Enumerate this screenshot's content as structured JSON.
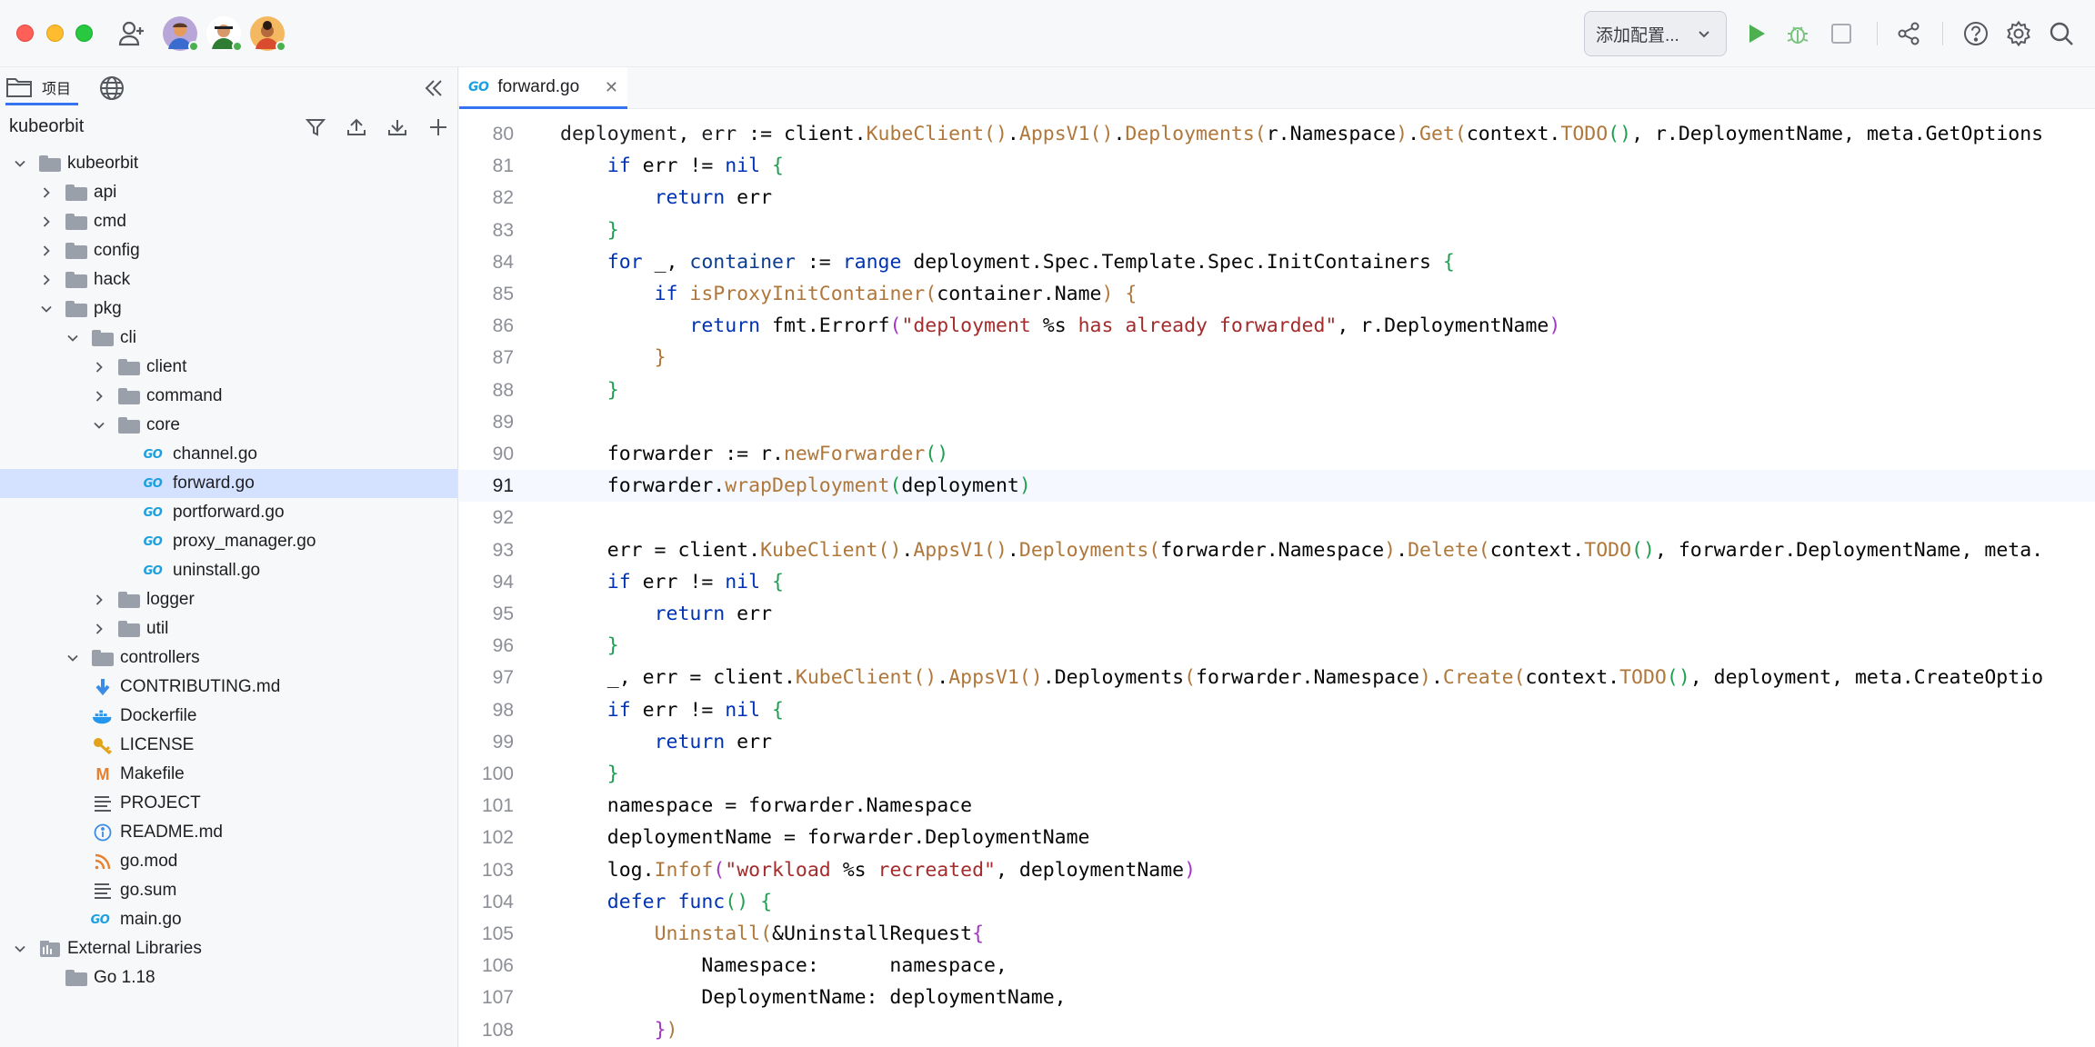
{
  "titlebar": {
    "run_config_label": "添加配置...",
    "colors": {
      "run": "#4caf50",
      "debug": "#4caf50"
    }
  },
  "left_panel": {
    "tab_project_label": "项目",
    "root_label": "kubeorbit",
    "tree": [
      {
        "label": "kubeorbit",
        "kind": "folder",
        "depth": 0,
        "expanded": true
      },
      {
        "label": "api",
        "kind": "folder",
        "depth": 1,
        "expanded": false
      },
      {
        "label": "cmd",
        "kind": "folder",
        "depth": 1,
        "expanded": false
      },
      {
        "label": "config",
        "kind": "folder",
        "depth": 1,
        "expanded": false
      },
      {
        "label": "hack",
        "kind": "folder",
        "depth": 1,
        "expanded": false
      },
      {
        "label": "pkg",
        "kind": "folder",
        "depth": 1,
        "expanded": true
      },
      {
        "label": "cli",
        "kind": "folder",
        "depth": 2,
        "expanded": true
      },
      {
        "label": "client",
        "kind": "folder",
        "depth": 3,
        "expanded": false
      },
      {
        "label": "command",
        "kind": "folder",
        "depth": 3,
        "expanded": false
      },
      {
        "label": "core",
        "kind": "folder",
        "depth": 3,
        "expanded": true
      },
      {
        "label": "channel.go",
        "kind": "go",
        "depth": 4
      },
      {
        "label": "forward.go",
        "kind": "go",
        "depth": 4,
        "selected": true
      },
      {
        "label": "portforward.go",
        "kind": "go",
        "depth": 4
      },
      {
        "label": "proxy_manager.go",
        "kind": "go",
        "depth": 4
      },
      {
        "label": "uninstall.go",
        "kind": "go",
        "depth": 4
      },
      {
        "label": "logger",
        "kind": "folder",
        "depth": 3,
        "expanded": false
      },
      {
        "label": "util",
        "kind": "folder",
        "depth": 3,
        "expanded": false
      },
      {
        "label": "controllers",
        "kind": "folder",
        "depth": 2,
        "expanded": true
      },
      {
        "label": "CONTRIBUTING.md",
        "kind": "md-down",
        "depth": 2
      },
      {
        "label": "Dockerfile",
        "kind": "docker",
        "depth": 2
      },
      {
        "label": "LICENSE",
        "kind": "key",
        "depth": 2
      },
      {
        "label": "Makefile",
        "kind": "make",
        "depth": 2
      },
      {
        "label": "PROJECT",
        "kind": "text",
        "depth": 2
      },
      {
        "label": "README.md",
        "kind": "info",
        "depth": 2
      },
      {
        "label": "go.mod",
        "kind": "rss",
        "depth": 2
      },
      {
        "label": "go.sum",
        "kind": "text",
        "depth": 2
      },
      {
        "label": "main.go",
        "kind": "go",
        "depth": 2
      },
      {
        "label": "External Libraries",
        "kind": "lib",
        "depth": 0,
        "expanded": true
      },
      {
        "label": "Go 1.18",
        "kind": "folder",
        "depth": 1
      }
    ]
  },
  "editor": {
    "tab_label": "forward.go",
    "go_badge": "GO",
    "current_line": 91,
    "lines": [
      {
        "n": "80",
        "tokens": [
          [
            "var",
            "deployment"
          ],
          [
            "p",
            ", "
          ],
          [
            "var",
            "err"
          ],
          [
            "p",
            " := client."
          ],
          [
            "fn",
            "KubeClient"
          ],
          [
            "br2",
            "()"
          ],
          [
            "p",
            "."
          ],
          [
            "fn",
            "AppsV1"
          ],
          [
            "br2",
            "()"
          ],
          [
            "p",
            "."
          ],
          [
            "fn",
            "Deployments"
          ],
          [
            "br2",
            "("
          ],
          [
            "p",
            "r.Namespace"
          ],
          [
            "br2",
            ")"
          ],
          [
            "p",
            "."
          ],
          [
            "fn",
            "Get"
          ],
          [
            "br2",
            "("
          ],
          [
            "p",
            "context."
          ],
          [
            "fn",
            "TODO"
          ],
          [
            "br1",
            "()"
          ],
          [
            "p",
            ", r.DeploymentName, meta.GetOptions"
          ]
        ]
      },
      {
        "n": "81",
        "tokens": [
          [
            "p",
            "    "
          ],
          [
            "kw",
            "if"
          ],
          [
            "p",
            " err != "
          ],
          [
            "kw",
            "nil"
          ],
          [
            "p",
            " "
          ],
          [
            "br1",
            "{"
          ]
        ]
      },
      {
        "n": "82",
        "tokens": [
          [
            "p",
            "        "
          ],
          [
            "kw",
            "return"
          ],
          [
            "p",
            " err"
          ]
        ]
      },
      {
        "n": "83",
        "tokens": [
          [
            "p",
            "    "
          ],
          [
            "br1",
            "}"
          ]
        ]
      },
      {
        "n": "84",
        "tokens": [
          [
            "p",
            "    "
          ],
          [
            "kw",
            "for"
          ],
          [
            "p",
            " _, "
          ],
          [
            "id",
            "container"
          ],
          [
            "p",
            " := "
          ],
          [
            "kw",
            "range"
          ],
          [
            "p",
            " deployment.Spec.Template.Spec.InitContainers "
          ],
          [
            "br1",
            "{"
          ]
        ]
      },
      {
        "n": "85",
        "tokens": [
          [
            "p",
            "        "
          ],
          [
            "kw",
            "if"
          ],
          [
            "p",
            " "
          ],
          [
            "fn",
            "isProxyInitContainer"
          ],
          [
            "br2",
            "("
          ],
          [
            "p",
            "container.Name"
          ],
          [
            "br2",
            ")"
          ],
          [
            "p",
            " "
          ],
          [
            "br2",
            "{"
          ]
        ]
      },
      {
        "n": "86",
        "tokens": [
          [
            "p",
            "           "
          ],
          [
            "kw",
            "return"
          ],
          [
            "p",
            " fmt."
          ],
          [
            "p",
            "Errorf"
          ],
          [
            "br3",
            "("
          ],
          [
            "str",
            "\"deployment "
          ],
          [
            "p",
            "%s"
          ],
          [
            "str",
            " has already forwarded\""
          ],
          [
            "p",
            ", r.DeploymentName"
          ],
          [
            "br3",
            ")"
          ]
        ]
      },
      {
        "n": "87",
        "tokens": [
          [
            "p",
            "        "
          ],
          [
            "br2",
            "}"
          ]
        ]
      },
      {
        "n": "88",
        "tokens": [
          [
            "p",
            "    "
          ],
          [
            "br1",
            "}"
          ]
        ]
      },
      {
        "n": "89",
        "tokens": []
      },
      {
        "n": "90",
        "tokens": [
          [
            "p",
            "    forwarder := r."
          ],
          [
            "fn",
            "newForwarder"
          ],
          [
            "br1",
            "()"
          ]
        ]
      },
      {
        "n": "91",
        "tokens": [
          [
            "p",
            "    forwarder."
          ],
          [
            "fn",
            "wrapDeployment"
          ],
          [
            "br1",
            "("
          ],
          [
            "p",
            "deployment"
          ],
          [
            "br1",
            ")"
          ]
        ]
      },
      {
        "n": "92",
        "tokens": []
      },
      {
        "n": "93",
        "tokens": [
          [
            "p",
            "    err = client."
          ],
          [
            "fn",
            "KubeClient"
          ],
          [
            "br2",
            "()"
          ],
          [
            "p",
            "."
          ],
          [
            "fn",
            "AppsV1"
          ],
          [
            "br2",
            "()"
          ],
          [
            "p",
            "."
          ],
          [
            "fn",
            "Deployments"
          ],
          [
            "br2",
            "("
          ],
          [
            "p",
            "forwarder.Namespace"
          ],
          [
            "br2",
            ")"
          ],
          [
            "p",
            "."
          ],
          [
            "fn",
            "Delete"
          ],
          [
            "br2",
            "("
          ],
          [
            "p",
            "context."
          ],
          [
            "fn",
            "TODO"
          ],
          [
            "br1",
            "()"
          ],
          [
            "p",
            ", forwarder.DeploymentName, meta."
          ]
        ]
      },
      {
        "n": "94",
        "tokens": [
          [
            "p",
            "    "
          ],
          [
            "kw",
            "if"
          ],
          [
            "p",
            " err != "
          ],
          [
            "kw",
            "nil"
          ],
          [
            "p",
            " "
          ],
          [
            "br1",
            "{"
          ]
        ]
      },
      {
        "n": "95",
        "tokens": [
          [
            "p",
            "        "
          ],
          [
            "kw",
            "return"
          ],
          [
            "p",
            " err"
          ]
        ]
      },
      {
        "n": "96",
        "tokens": [
          [
            "p",
            "    "
          ],
          [
            "br1",
            "}"
          ]
        ]
      },
      {
        "n": "97",
        "tokens": [
          [
            "p",
            "    _, err = client."
          ],
          [
            "fn",
            "KubeClient"
          ],
          [
            "br2",
            "()"
          ],
          [
            "p",
            "."
          ],
          [
            "fn",
            "AppsV1"
          ],
          [
            "br2",
            "()"
          ],
          [
            "p",
            ".Deployments"
          ],
          [
            "br2",
            "("
          ],
          [
            "p",
            "forwarder.Namespace"
          ],
          [
            "br2",
            ")"
          ],
          [
            "p",
            "."
          ],
          [
            "fn",
            "Create"
          ],
          [
            "br2",
            "("
          ],
          [
            "p",
            "context."
          ],
          [
            "fn",
            "TODO"
          ],
          [
            "br1",
            "()"
          ],
          [
            "p",
            ", deployment, meta.CreateOptio"
          ]
        ]
      },
      {
        "n": "98",
        "tokens": [
          [
            "p",
            "    "
          ],
          [
            "kw",
            "if"
          ],
          [
            "p",
            " err != "
          ],
          [
            "kw",
            "nil"
          ],
          [
            "p",
            " "
          ],
          [
            "br1",
            "{"
          ]
        ]
      },
      {
        "n": "99",
        "tokens": [
          [
            "p",
            "        "
          ],
          [
            "kw",
            "return"
          ],
          [
            "p",
            " err"
          ]
        ]
      },
      {
        "n": "100",
        "tokens": [
          [
            "p",
            "    "
          ],
          [
            "br1",
            "}"
          ]
        ]
      },
      {
        "n": "101",
        "tokens": [
          [
            "p",
            "    namespace = forwarder.Namespace"
          ]
        ]
      },
      {
        "n": "102",
        "tokens": [
          [
            "p",
            "    deploymentName = forwarder.DeploymentName"
          ]
        ]
      },
      {
        "n": "103",
        "tokens": [
          [
            "p",
            "    log."
          ],
          [
            "fn",
            "Infof"
          ],
          [
            "br3",
            "("
          ],
          [
            "str",
            "\"workload "
          ],
          [
            "p",
            "%s"
          ],
          [
            "str",
            " recreated\""
          ],
          [
            "p",
            ", deploymentName"
          ],
          [
            "br3",
            ")"
          ]
        ]
      },
      {
        "n": "104",
        "tokens": [
          [
            "p",
            "    "
          ],
          [
            "kw",
            "defer"
          ],
          [
            "p",
            " "
          ],
          [
            "kw",
            "func"
          ],
          [
            "br1",
            "()"
          ],
          [
            "p",
            " "
          ],
          [
            "br1",
            "{"
          ]
        ]
      },
      {
        "n": "105",
        "tokens": [
          [
            "p",
            "        "
          ],
          [
            "fn",
            "Uninstall"
          ],
          [
            "br2",
            "("
          ],
          [
            "p",
            "&UninstallRequest"
          ],
          [
            "br3",
            "{"
          ]
        ]
      },
      {
        "n": "106",
        "tokens": [
          [
            "p",
            "            Namespace:      namespace,"
          ]
        ]
      },
      {
        "n": "107",
        "tokens": [
          [
            "p",
            "            DeploymentName: deploymentName,"
          ]
        ]
      },
      {
        "n": "108",
        "tokens": [
          [
            "p",
            "        "
          ],
          [
            "br3",
            "}"
          ],
          [
            "br2",
            ")"
          ]
        ]
      }
    ]
  }
}
